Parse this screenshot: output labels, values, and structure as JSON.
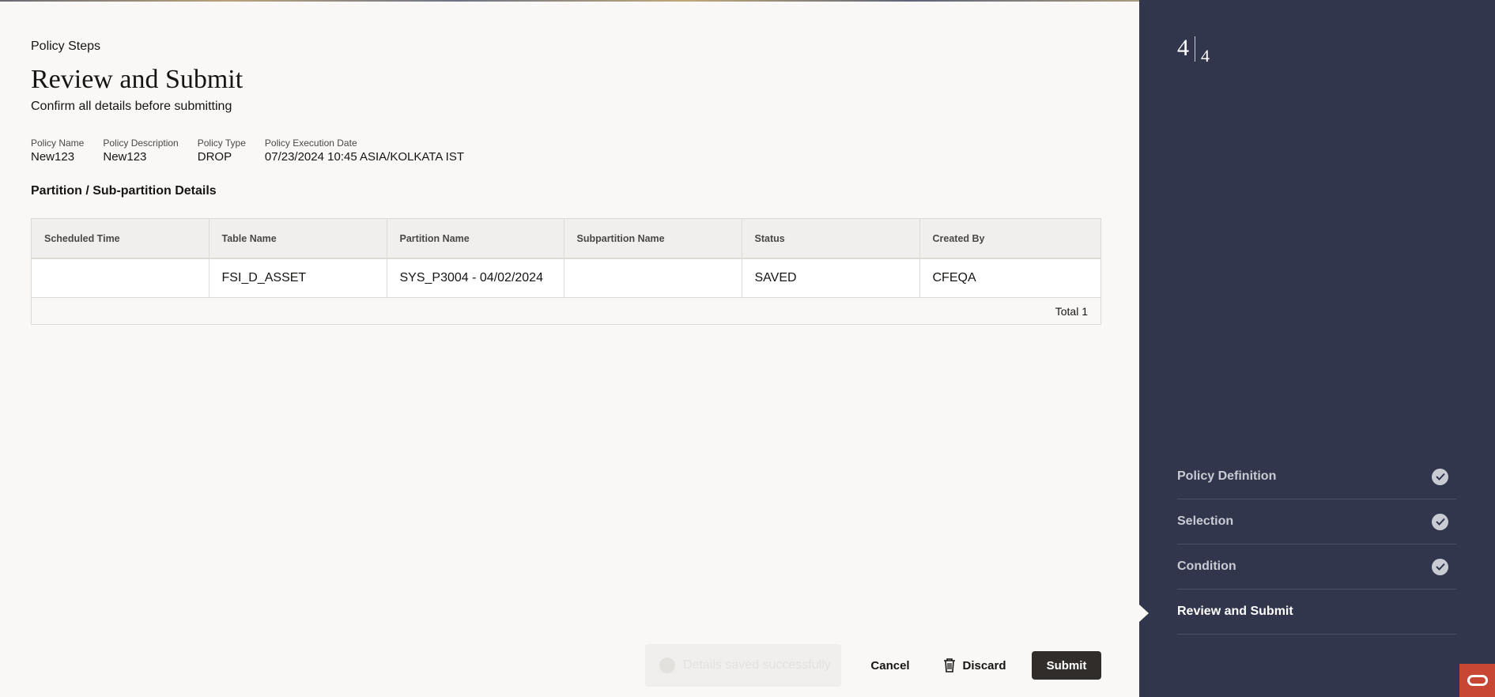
{
  "header": {
    "eyebrow": "Policy Steps",
    "title": "Review and Submit",
    "subtitle": "Confirm all details before submitting"
  },
  "meta": [
    {
      "label": "Policy Name",
      "value": "New123"
    },
    {
      "label": "Policy Description",
      "value": "New123"
    },
    {
      "label": "Policy Type",
      "value": "DROP"
    },
    {
      "label": "Policy Execution Date",
      "value": "07/23/2024 10:45 ASIA/KOLKATA IST"
    }
  ],
  "section": {
    "title": "Partition / Sub-partition Details"
  },
  "table": {
    "columns": [
      "Scheduled Time",
      "Table Name",
      "Partition Name",
      "Subpartition Name",
      "Status",
      "Created By"
    ],
    "rows": [
      [
        "",
        "FSI_D_ASSET",
        "SYS_P3004 - 04/02/2024",
        "",
        "SAVED",
        "CFEQA"
      ]
    ],
    "footer": "Total 1"
  },
  "toast": {
    "text": "Details saved successfully"
  },
  "actions": {
    "cancel": "Cancel",
    "discard": "Discard",
    "submit": "Submit"
  },
  "sidebar": {
    "step_current": "4",
    "step_total": "4",
    "steps": [
      {
        "label": "Policy Definition",
        "done": true
      },
      {
        "label": "Selection",
        "done": true
      },
      {
        "label": "Condition",
        "done": true
      },
      {
        "label": "Review and Submit",
        "done": false
      }
    ]
  },
  "colors": {
    "sidebar_bg": "#31364c",
    "submit_bg": "#312d2a",
    "brand_red": "#c74634"
  }
}
